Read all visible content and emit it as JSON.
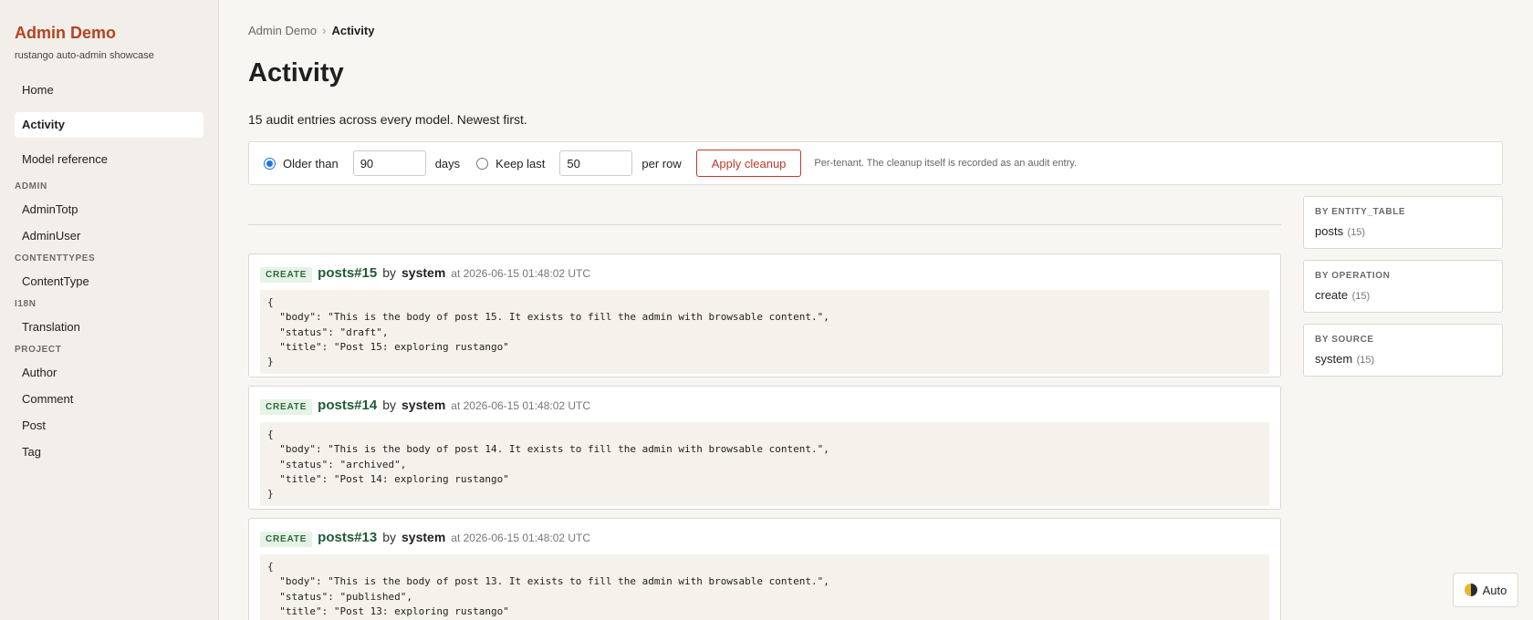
{
  "sidebar": {
    "brand": "Admin Demo",
    "tagline": "rustango auto-admin showcase",
    "top_items": [
      "Home",
      "Activity",
      "Model reference"
    ],
    "sections": [
      {
        "title": "ADMIN",
        "items": [
          "AdminTotp",
          "AdminUser"
        ]
      },
      {
        "title": "CONTENTTYPES",
        "items": [
          "ContentType"
        ]
      },
      {
        "title": "I18N",
        "items": [
          "Translation"
        ]
      },
      {
        "title": "PROJECT",
        "items": [
          "Author",
          "Comment",
          "Post",
          "Tag"
        ]
      }
    ]
  },
  "breadcrumb": {
    "root": "Admin Demo",
    "separator": "›",
    "current": "Activity"
  },
  "page": {
    "title": "Activity",
    "summary": "15 audit entries across every model. Newest first."
  },
  "cleanup": {
    "older_than_label": "Older than",
    "older_than_value": "90",
    "days_label": "days",
    "keep_last_label": "Keep last",
    "keep_last_value": "50",
    "per_row_label": "per row",
    "apply_label": "Apply cleanup",
    "note": "Per-tenant. The cleanup itself is recorded as an audit entry."
  },
  "entries": [
    {
      "operation": "CREATE",
      "entity": "posts#15",
      "by": "by",
      "actor": "system",
      "at": "at 2026-06-15 01:48:02 UTC",
      "body": "{\n  \"body\": \"This is the body of post 15. It exists to fill the admin with browsable content.\",\n  \"status\": \"draft\",\n  \"title\": \"Post 15: exploring rustango\"\n}"
    },
    {
      "operation": "CREATE",
      "entity": "posts#14",
      "by": "by",
      "actor": "system",
      "at": "at 2026-06-15 01:48:02 UTC",
      "body": "{\n  \"body\": \"This is the body of post 14. It exists to fill the admin with browsable content.\",\n  \"status\": \"archived\",\n  \"title\": \"Post 14: exploring rustango\"\n}"
    },
    {
      "operation": "CREATE",
      "entity": "posts#13",
      "by": "by",
      "actor": "system",
      "at": "at 2026-06-15 01:48:02 UTC",
      "body": "{\n  \"body\": \"This is the body of post 13. It exists to fill the admin with browsable content.\",\n  \"status\": \"published\",\n  \"title\": \"Post 13: exploring rustango\"\n}"
    }
  ],
  "facets": [
    {
      "title": "BY ENTITY_TABLE",
      "value": "posts",
      "count": "(15)"
    },
    {
      "title": "BY OPERATION",
      "value": "create",
      "count": "(15)"
    },
    {
      "title": "BY SOURCE",
      "value": "system",
      "count": "(15)"
    }
  ],
  "theme": {
    "label": "Auto",
    "icon": "half-moon-icon"
  }
}
